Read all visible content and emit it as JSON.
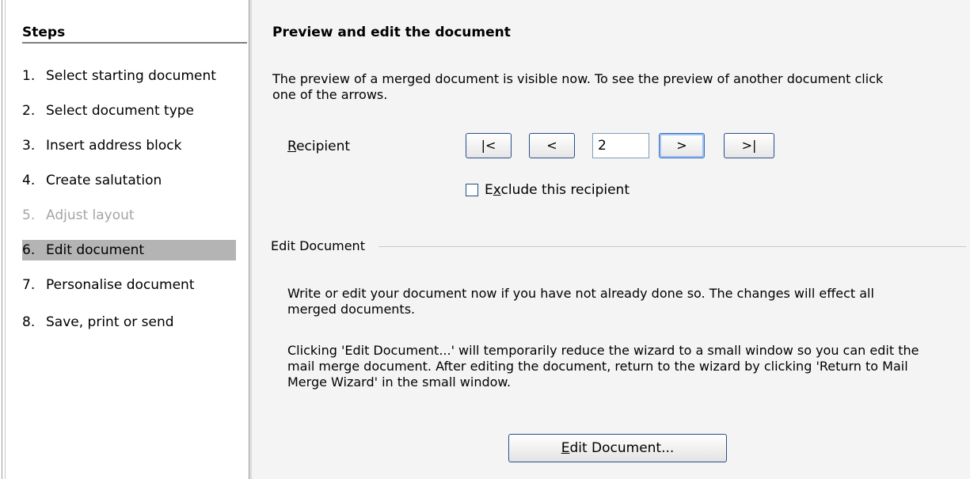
{
  "sidebar": {
    "title": "Steps",
    "items": [
      {
        "num": "1.",
        "label": "Select starting document",
        "state": "normal"
      },
      {
        "num": "2.",
        "label": "Select document type",
        "state": "normal"
      },
      {
        "num": "3.",
        "label": "Insert address block",
        "state": "normal"
      },
      {
        "num": "4.",
        "label": "Create salutation",
        "state": "normal"
      },
      {
        "num": "5.",
        "label": "Adjust layout",
        "state": "disabled"
      },
      {
        "num": "6.",
        "label": "Edit document",
        "state": "selected"
      },
      {
        "num": "7.",
        "label": "Personalise document",
        "state": "normal"
      },
      {
        "num": "8.",
        "label": "Save, print or send",
        "state": "normal"
      }
    ]
  },
  "main": {
    "title": "Preview and edit the document",
    "intro_line1": "The preview of a merged document is visible now. To see the preview of another document click",
    "intro_line2": "one of the arrows.",
    "recipient": {
      "label_access": "R",
      "label_rest": "ecipient",
      "first_label": "|<",
      "prev_label": "<",
      "value": "2",
      "next_label": ">",
      "last_label": ">|"
    },
    "exclude": {
      "label_pre": "E",
      "label_access": "x",
      "label_rest": "clude this recipient",
      "checked": false
    },
    "edit_section": {
      "label": "Edit Document",
      "para1_line1": "Write or edit your document now if you have not already done so. The changes will effect all",
      "para1_line2": "merged documents.",
      "para2_line1": "Clicking 'Edit Document...' will temporarily reduce the wizard to a small window so you can edit the",
      "para2_line2": "mail merge document. After editing the document, return to the wizard by clicking 'Return to Mail",
      "para2_line3": "Merge Wizard' in the small window.",
      "button_access": "E",
      "button_rest": "dit Document..."
    }
  },
  "colors": {
    "selected_step_bg": "#b4b4b4",
    "disabled_text": "#a5a5a5",
    "panel_bg": "#f4f4f4",
    "button_border": "#2a4d8a"
  }
}
